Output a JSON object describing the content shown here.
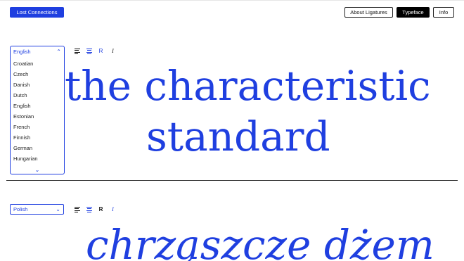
{
  "header": {
    "brand_label": "Lost Connections",
    "nav": [
      "About Ligatures",
      "Typeface",
      "Info"
    ]
  },
  "specimen1": {
    "language": "English",
    "languages": [
      "Croatian",
      "Czech",
      "Danish",
      "Dutch",
      "English",
      "Estonian",
      "French",
      "Finnish",
      "German",
      "Hungarian"
    ],
    "line1": "the characteristic",
    "line2": "standard",
    "tools": [
      "align-left",
      "align-center",
      "R",
      "I"
    ]
  },
  "specimen2": {
    "language": "Polish",
    "text": "chrząszcze dżem",
    "tools": [
      "align-left",
      "align-center",
      "R",
      "I"
    ]
  },
  "colors": {
    "accent": "#1f3fe0",
    "text": "#111111",
    "background": "#ffffff"
  }
}
